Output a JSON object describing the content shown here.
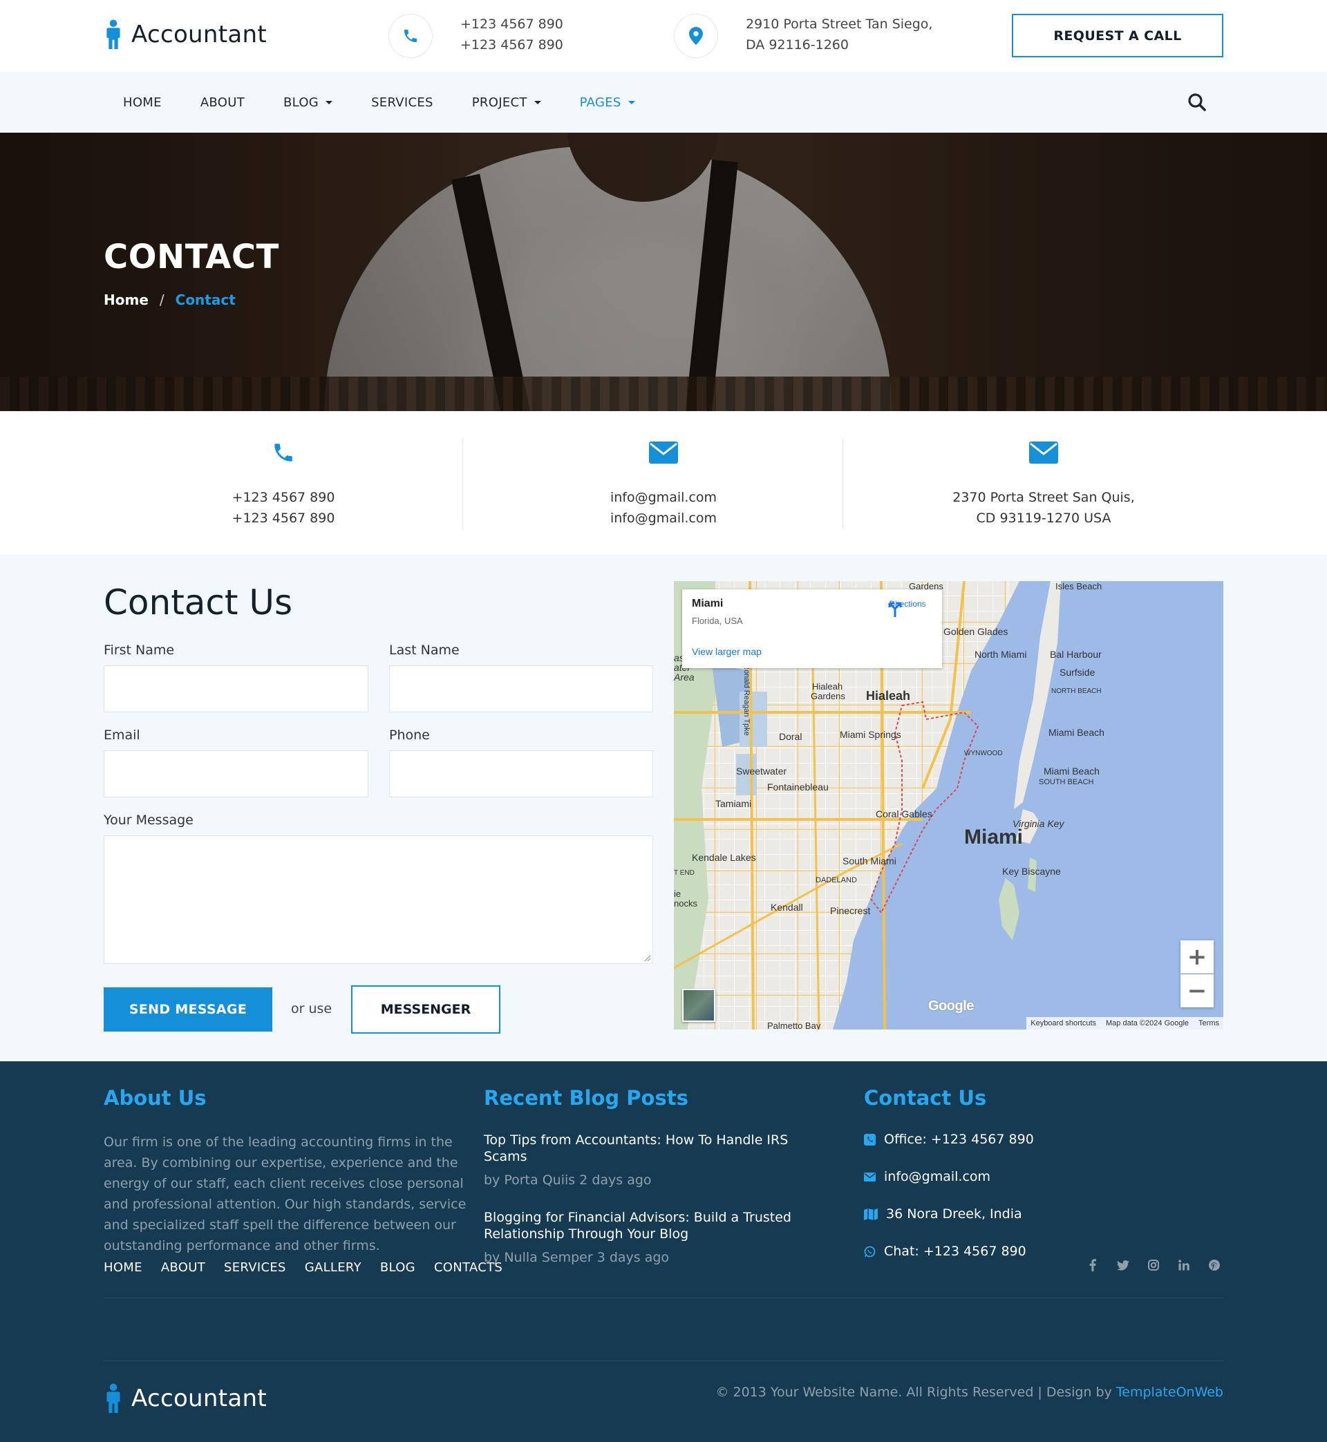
{
  "brand": {
    "name": "Accountant"
  },
  "topbar": {
    "phone_line1": "+123 4567 890",
    "phone_line2": "+123 4567 890",
    "address_line1": "2910 Porta Street Tan Siego,",
    "address_line2": "DA 92116-1260",
    "request_button": "REQUEST A CALL"
  },
  "nav": {
    "items": [
      {
        "label": "HOME"
      },
      {
        "label": "ABOUT"
      },
      {
        "label": "BLOG"
      },
      {
        "label": "SERVICES"
      },
      {
        "label": "PROJECT"
      },
      {
        "label": "PAGES"
      }
    ]
  },
  "hero": {
    "title": "CONTACT",
    "breadcrumb_home": "Home",
    "breadcrumb_sep": "/",
    "breadcrumb_current": "Contact"
  },
  "info": {
    "phone_line1": "+123 4567 890",
    "phone_line2": "+123 4567 890",
    "email_line1": "info@gmail.com",
    "email_line2": "info@gmail.com",
    "address_line1": "2370 Porta Street San Quis,",
    "address_line2": "CD 93119-1270 USA"
  },
  "form": {
    "title": "Contact Us",
    "first_name_label": "First Name",
    "last_name_label": "Last Name",
    "email_label": "Email",
    "phone_label": "Phone",
    "message_label": "Your Message",
    "send_button": "SEND MESSAGE",
    "or_use": "or use",
    "messenger_button": "MESSENGER"
  },
  "map": {
    "place_name": "Miami",
    "place_region": "Florida, USA",
    "directions": "Directions",
    "view_larger": "View larger map",
    "zoom_in": "+",
    "zoom_out": "−",
    "google_logo": "Google",
    "footer_shortcuts": "Keyboard shortcuts",
    "footer_data": "Map data ©2024 Google",
    "footer_terms": "Terms",
    "labels": {
      "miami": "Miami",
      "hialeah": "Hialeah",
      "hialeah_gardens": "Hialeah",
      "hialeah_gardens2": "Gardens",
      "doral": "Doral",
      "miami_springs": "Miami Springs",
      "sweetwater": "Sweetwater",
      "fontainebleau": "Fontainebleau",
      "tamiami": "Tamiami",
      "coral_gables": "Coral Gables",
      "south_miami": "South Miami",
      "kendale_lakes": "Kendale Lakes",
      "kendall": "Kendall",
      "pinecrest": "Pinecrest",
      "dadeland": "DADELAND",
      "key_biscayne": "Key Biscayne",
      "virginia_key": "Virginia Key",
      "miami_beach": "Miami Beach",
      "miami_beach_s": "Miami Beach",
      "south_beach": "SOUTH BEACH",
      "north_miami": "North Miami",
      "bal_harbour": "Bal Harbour",
      "surfside": "Surfside",
      "north_beach": "NORTH BEACH",
      "golden_glades": "Golden Glades",
      "isles_beach": "Isles Beach",
      "gardens": "Gardens",
      "wynwood": "WYNWOOD",
      "ronald_reagan": "Ronald Reagan Tpke",
      "east_water": "ast",
      "east_water2": "ater",
      "east_water3": "Area",
      "t_end": "T END",
      "hocks": "ie",
      "hocks2": "nocks",
      "palmetto": "Palmetto Bay"
    }
  },
  "footer": {
    "about_title": "About Us",
    "about_text": "Our firm is one of the leading accounting firms in the area. By combining our expertise, experience and the energy of our staff, each client receives close personal and professional attention. Our high standards, service and specialized staff spell the difference between our outstanding performance and other firms.",
    "posts_title": "Recent Blog Posts",
    "posts": [
      {
        "title": "Top Tips from Accountants: How To Handle IRS Scams",
        "meta": "by Porta Quiis 2 days ago"
      },
      {
        "title": "Blogging for Financial Advisors: Build a Trusted Relationship Through Your Blog",
        "meta": "by Nulla Semper 3 days ago"
      }
    ],
    "contact_title": "Contact Us",
    "office": "Office: +123 4567 890",
    "email": "info@gmail.com",
    "address": "36 Nora Dreek, India",
    "chat": "Chat: +123 4567 890",
    "nav": [
      "HOME",
      "ABOUT",
      "SERVICES",
      "GALLERY",
      "BLOG",
      "CONTACTS"
    ],
    "socials": [
      "facebook-icon",
      "twitter-icon",
      "instagram-icon",
      "linkedin-icon",
      "pinterest-icon"
    ],
    "copyright": "© 2013 Your Website Name. All Rights Reserved | Design by",
    "copyright_link": "TemplateOnWeb"
  },
  "colors": {
    "accent": "#1590d8",
    "footer_bg": "#163a52",
    "section_bg": "#f3f8fd"
  }
}
